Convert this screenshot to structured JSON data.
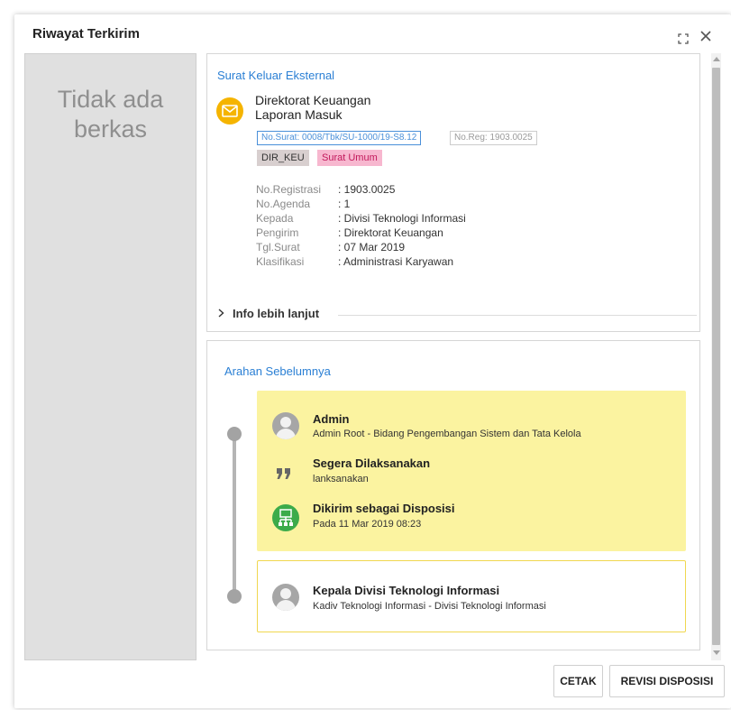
{
  "dialog": {
    "title": "Riwayat Terkirim"
  },
  "files": {
    "empty_text": "Tidak ada berkas"
  },
  "letter": {
    "section_title": "Surat Keluar Eksternal",
    "sender_unit": "Direktorat Keuangan",
    "status": "Laporan Masuk",
    "tags_outline": [
      {
        "text": "No.Surat: 0008/Tbk/SU-1000/19-S8.12",
        "color": "#4a90d9"
      },
      {
        "text": "No.Reg: 1903.0025",
        "color": "#9a9a9a"
      }
    ],
    "tags_fill": [
      {
        "text": "DIR_KEU",
        "bg": "#d8cfcf",
        "color": "#333333"
      },
      {
        "text": "Surat Umum",
        "bg": "#f7b7cf",
        "color": "#c2185b"
      }
    ],
    "meta": [
      {
        "label": "No.Registrasi",
        "value": ": 1903.0025"
      },
      {
        "label": "No.Agenda",
        "value": ": 1"
      },
      {
        "label": "Kepada",
        "value": ": Divisi Teknologi Informasi"
      },
      {
        "label": "Pengirim",
        "value": ": Direktorat Keuangan"
      },
      {
        "label": "Tgl.Surat",
        "value": ": 07 Mar 2019"
      },
      {
        "label": "Klasifikasi",
        "value": ": Administrasi Karyawan"
      }
    ],
    "more_info": "Info lebih lanjut"
  },
  "history": {
    "section_title": "Arahan Sebelumnya",
    "entries": [
      {
        "author": "Admin",
        "author_detail": "Admin Root - Bidang Pengembangan Sistem dan Tata Kelola",
        "note_title": "Segera Dilaksanakan",
        "note_text": "lanksanakan",
        "action_title": "Dikirim sebagai Disposisi",
        "action_text": "Pada 11 Mar 2019 08:23"
      },
      {
        "author": "Kepala Divisi Teknologi Informasi",
        "author_detail": "Kadiv Teknologi Informasi - Divisi Teknologi Informasi"
      }
    ]
  },
  "footer": {
    "print_label": "CETAK",
    "revise_label": "REVISI DISPOSISI"
  },
  "icons": {
    "mail": "envelope-icon",
    "quote": "quote-icon",
    "disposition": "org-chart-icon",
    "maximize": "expand-icon",
    "close": "close-icon"
  },
  "colors": {
    "accent": "#2a7fd4",
    "mail_badge": "#f5b400",
    "highlight_bg": "#fbf3a0",
    "disposition_badge": "#3cab4a"
  }
}
